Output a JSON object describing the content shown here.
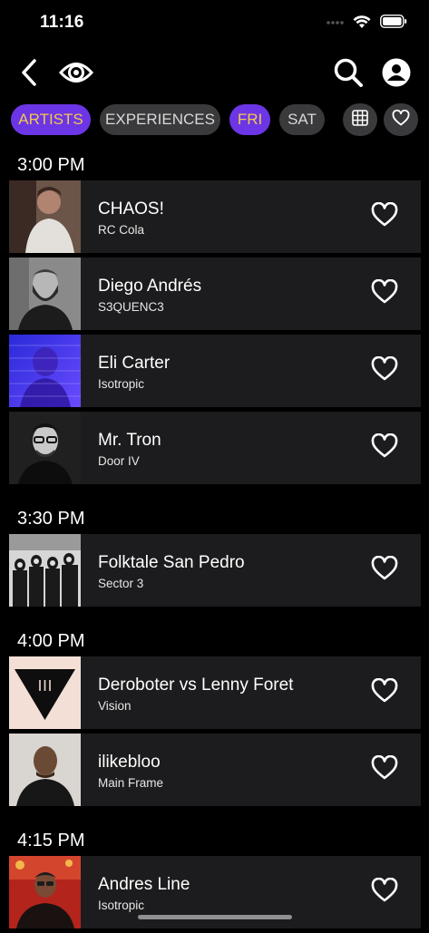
{
  "status_bar": {
    "time": "11:16"
  },
  "nav": {
    "back_icon": "chevron-left-icon",
    "logo_icon": "eye-logo-icon",
    "search_icon": "search-icon",
    "profile_icon": "user-profile-icon"
  },
  "filters": {
    "artists": "ARTISTS",
    "experiences": "EXPERIENCES",
    "fri": "FRI",
    "sat": "SAT",
    "grid_icon": "grid-icon",
    "favorites_icon": "heart-icon"
  },
  "colors": {
    "accent": "#6c35e6",
    "accent_text": "#f2c94c",
    "row_bg": "#1c1c1e",
    "chip_bg": "#3a3a3c"
  },
  "schedule": [
    {
      "time": "3:00 PM",
      "artists": [
        {
          "name": "CHAOS!",
          "stage": "RC Cola"
        },
        {
          "name": "Diego Andrés",
          "stage": "S3QUENC3"
        },
        {
          "name": "Eli Carter",
          "stage": "Isotropic"
        },
        {
          "name": "Mr. Tron",
          "stage": "Door IV"
        }
      ]
    },
    {
      "time": "3:30 PM",
      "artists": [
        {
          "name": "Folktale San Pedro",
          "stage": "Sector 3"
        }
      ]
    },
    {
      "time": "4:00 PM",
      "artists": [
        {
          "name": "Deroboter vs Lenny Foret",
          "stage": "Vision"
        },
        {
          "name": "ilikebloo",
          "stage": "Main Frame"
        }
      ]
    },
    {
      "time": "4:15 PM",
      "artists": [
        {
          "name": "Andres Line",
          "stage": "Isotropic"
        }
      ]
    }
  ]
}
